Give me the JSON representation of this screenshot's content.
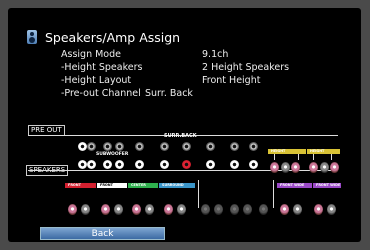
{
  "header": {
    "title": "Speakers/Amp Assign",
    "icon": "speaker-icon"
  },
  "settings": [
    {
      "label": "Assign Mode",
      "value": "9.1ch"
    },
    {
      "label": "-Height Speakers",
      "value": "2 Height Speakers"
    },
    {
      "label": "-Height Layout",
      "value": "Front Height"
    },
    {
      "label": "-Pre-out Channel",
      "value": "Surr. Back"
    }
  ],
  "diagram": {
    "pre_out_label": "PRE OUT",
    "speakers_label": "SPEAKERS",
    "surr_back_label": "SURR.BACK",
    "subwoofer_label": "SUBWOOFER",
    "bars": {
      "height_left": "HEIGHT",
      "height_right": "HEIGHT",
      "front": "FRONT",
      "front2": "FRONT",
      "center": "CENTER",
      "surround": "SURROUND",
      "front_wide_left": "FRONT WIDE",
      "front_wide_right": "FRONT WIDE"
    },
    "colors": {
      "height": "#d8c235",
      "front_red": "#d32030",
      "front_white": "#ffffff",
      "center": "#2fb04e",
      "surround": "#3a95c9",
      "front_wide": "#9a49c7"
    }
  },
  "footer": {
    "back_label": "Back"
  }
}
